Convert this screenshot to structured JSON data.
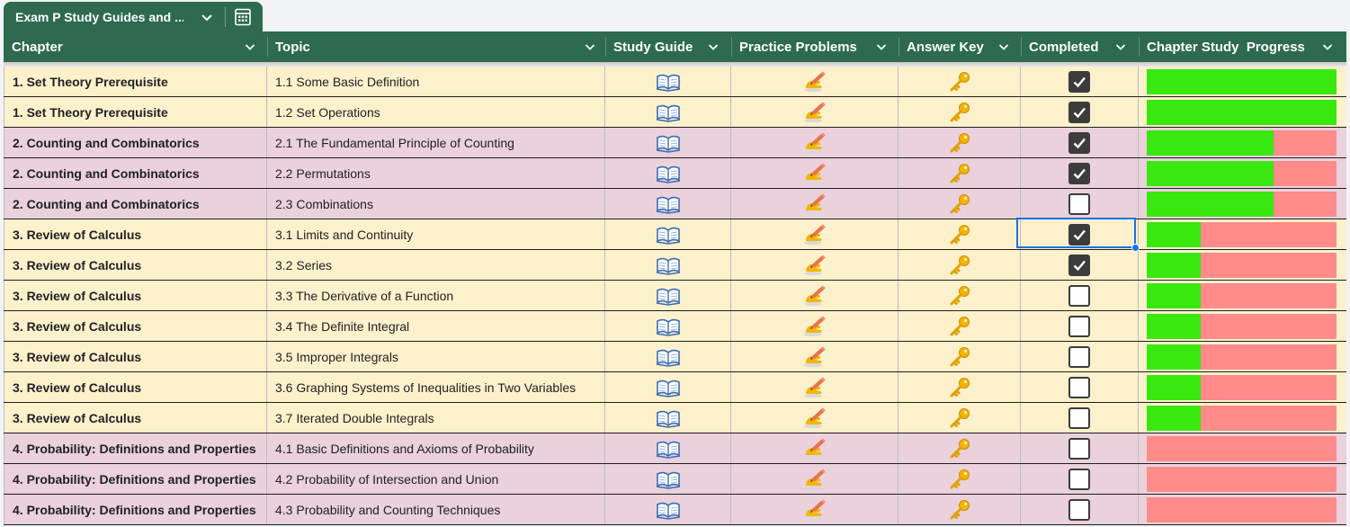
{
  "tab": {
    "title": "Exam P Study Guides and ..."
  },
  "columns": {
    "chapter": "Chapter",
    "topic": "Topic",
    "study_guide": "Study Guide",
    "practice_problems": "Practice Problems",
    "answer_key": "Answer Key",
    "completed": "Completed",
    "progress": "Chapter Study  Progress"
  },
  "colors": {
    "header": "#2d6a4f",
    "row_yellow": "#fdf1cc",
    "row_pink": "#ead1dc",
    "progress_done": "#39e80f",
    "progress_remaining": "#ff8b8b"
  },
  "rows": [
    {
      "chapter": "1. Set Theory Prerequisite",
      "topic": "1.1 Some Basic Definition",
      "completed": true,
      "progress": 1.0,
      "tone": "yellow"
    },
    {
      "chapter": "1. Set Theory Prerequisite",
      "topic": "1.2 Set Operations",
      "completed": true,
      "progress": 1.0,
      "tone": "yellow"
    },
    {
      "chapter": "2. Counting and Combinatorics",
      "topic": "2.1 The Fundamental Principle of Counting",
      "completed": true,
      "progress": 0.667,
      "tone": "pink"
    },
    {
      "chapter": "2. Counting and Combinatorics",
      "topic": "2.2 Permutations",
      "completed": true,
      "progress": 0.667,
      "tone": "pink"
    },
    {
      "chapter": "2. Counting and Combinatorics",
      "topic": "2.3 Combinations",
      "completed": false,
      "progress": 0.667,
      "tone": "pink"
    },
    {
      "chapter": "3. Review of Calculus",
      "topic": "3.1 Limits and Continuity",
      "completed": true,
      "progress": 0.286,
      "tone": "yellow"
    },
    {
      "chapter": "3. Review of Calculus",
      "topic": "3.2 Series",
      "completed": true,
      "progress": 0.286,
      "tone": "yellow"
    },
    {
      "chapter": "3. Review of Calculus",
      "topic": "3.3 The Derivative of a Function",
      "completed": false,
      "progress": 0.286,
      "tone": "yellow"
    },
    {
      "chapter": "3. Review of Calculus",
      "topic": "3.4 The Definite Integral",
      "completed": false,
      "progress": 0.286,
      "tone": "yellow"
    },
    {
      "chapter": "3. Review of Calculus",
      "topic": "3.5 Improper Integrals",
      "completed": false,
      "progress": 0.286,
      "tone": "yellow"
    },
    {
      "chapter": "3. Review of Calculus",
      "topic": "3.6 Graphing Systems of Inequalities in Two Variables",
      "completed": false,
      "progress": 0.286,
      "tone": "yellow"
    },
    {
      "chapter": "3. Review of Calculus",
      "topic": "3.7 Iterated Double Integrals",
      "completed": false,
      "progress": 0.286,
      "tone": "yellow"
    },
    {
      "chapter": "4. Probability: Definitions and Properties",
      "topic": "4.1 Basic Definitions and Axioms of Probability",
      "completed": false,
      "progress": 0.0,
      "tone": "pink"
    },
    {
      "chapter": "4. Probability: Definitions and Properties",
      "topic": "4.2 Probability of Intersection and Union",
      "completed": false,
      "progress": 0.0,
      "tone": "pink"
    },
    {
      "chapter": "4. Probability: Definitions and Properties",
      "topic": "4.3 Probability and Counting Techniques",
      "completed": false,
      "progress": 0.0,
      "tone": "pink"
    }
  ],
  "icons": {
    "study_guide": "open-book-icon",
    "practice": "writing-hand-icon",
    "answer_key": "key-icon",
    "table_view": "table-grid-icon",
    "dropdown": "chevron-down-icon"
  },
  "selected_row": 6
}
